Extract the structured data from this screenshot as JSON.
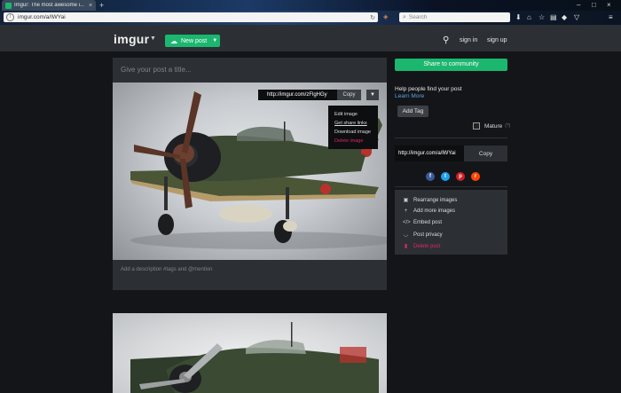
{
  "browser": {
    "tab_title": "Imgur: The most awesome i...",
    "tab_close": "×",
    "new_tab": "+",
    "address": "imgur.com/a/lWYai",
    "search_placeholder": "Search",
    "window_controls": [
      "–",
      "□",
      "×"
    ],
    "toolbar_icons": [
      "download-icon",
      "home-icon",
      "bookmark-star-icon",
      "reader-icon",
      "shield-icon",
      "pocket-icon",
      "menu-icon"
    ]
  },
  "header": {
    "logo": "imgur",
    "new_post_label": "New post",
    "sign_in": "sign in",
    "sign_up": "sign up"
  },
  "post": {
    "title_placeholder": "Give your post a title...",
    "description_placeholder": "Add a description #tags and @mention",
    "image_link": "http://imgur.com/zFlgHGy",
    "copy_label": "Copy",
    "menu": {
      "items": [
        "Edit image",
        "Get share links",
        "Download image",
        "Delete image"
      ]
    }
  },
  "sidebar": {
    "share_button": "Share to community",
    "help_text": "Help people find your post",
    "learn_more": "Learn More",
    "add_tag": "Add Tag",
    "mature_label": "Mature",
    "mature_hint": "(?)",
    "share_url": "http://imgur.com/a/lWYai",
    "share_copy": "Copy",
    "social": [
      "facebook",
      "twitter",
      "pinterest",
      "reddit"
    ],
    "options": [
      {
        "label": "Rearrange images",
        "icon": "rearrange-icon"
      },
      {
        "label": "Add more images",
        "icon": "plus-icon"
      },
      {
        "label": "Embed post",
        "icon": "code-icon"
      },
      {
        "label": "Post privacy",
        "icon": "eye-icon"
      },
      {
        "label": "Delete post",
        "icon": "trash-icon"
      }
    ]
  },
  "colors": {
    "accent_green": "#1bb76e",
    "delete_pink": "#e0256e",
    "link_blue": "#5ea2e8",
    "background": "#141518",
    "panel": "#2c2f34"
  }
}
